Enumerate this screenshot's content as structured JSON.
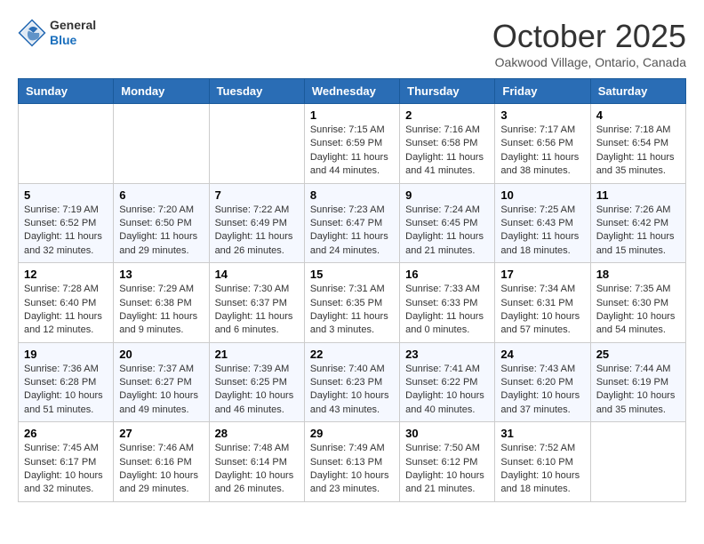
{
  "header": {
    "logo_line1": "General",
    "logo_line2": "Blue",
    "month": "October 2025",
    "location": "Oakwood Village, Ontario, Canada"
  },
  "weekdays": [
    "Sunday",
    "Monday",
    "Tuesday",
    "Wednesday",
    "Thursday",
    "Friday",
    "Saturday"
  ],
  "weeks": [
    [
      {
        "day": "",
        "sunrise": "",
        "sunset": "",
        "daylight": ""
      },
      {
        "day": "",
        "sunrise": "",
        "sunset": "",
        "daylight": ""
      },
      {
        "day": "",
        "sunrise": "",
        "sunset": "",
        "daylight": ""
      },
      {
        "day": "1",
        "sunrise": "Sunrise: 7:15 AM",
        "sunset": "Sunset: 6:59 PM",
        "daylight": "Daylight: 11 hours and 44 minutes."
      },
      {
        "day": "2",
        "sunrise": "Sunrise: 7:16 AM",
        "sunset": "Sunset: 6:58 PM",
        "daylight": "Daylight: 11 hours and 41 minutes."
      },
      {
        "day": "3",
        "sunrise": "Sunrise: 7:17 AM",
        "sunset": "Sunset: 6:56 PM",
        "daylight": "Daylight: 11 hours and 38 minutes."
      },
      {
        "day": "4",
        "sunrise": "Sunrise: 7:18 AM",
        "sunset": "Sunset: 6:54 PM",
        "daylight": "Daylight: 11 hours and 35 minutes."
      }
    ],
    [
      {
        "day": "5",
        "sunrise": "Sunrise: 7:19 AM",
        "sunset": "Sunset: 6:52 PM",
        "daylight": "Daylight: 11 hours and 32 minutes."
      },
      {
        "day": "6",
        "sunrise": "Sunrise: 7:20 AM",
        "sunset": "Sunset: 6:50 PM",
        "daylight": "Daylight: 11 hours and 29 minutes."
      },
      {
        "day": "7",
        "sunrise": "Sunrise: 7:22 AM",
        "sunset": "Sunset: 6:49 PM",
        "daylight": "Daylight: 11 hours and 26 minutes."
      },
      {
        "day": "8",
        "sunrise": "Sunrise: 7:23 AM",
        "sunset": "Sunset: 6:47 PM",
        "daylight": "Daylight: 11 hours and 24 minutes."
      },
      {
        "day": "9",
        "sunrise": "Sunrise: 7:24 AM",
        "sunset": "Sunset: 6:45 PM",
        "daylight": "Daylight: 11 hours and 21 minutes."
      },
      {
        "day": "10",
        "sunrise": "Sunrise: 7:25 AM",
        "sunset": "Sunset: 6:43 PM",
        "daylight": "Daylight: 11 hours and 18 minutes."
      },
      {
        "day": "11",
        "sunrise": "Sunrise: 7:26 AM",
        "sunset": "Sunset: 6:42 PM",
        "daylight": "Daylight: 11 hours and 15 minutes."
      }
    ],
    [
      {
        "day": "12",
        "sunrise": "Sunrise: 7:28 AM",
        "sunset": "Sunset: 6:40 PM",
        "daylight": "Daylight: 11 hours and 12 minutes."
      },
      {
        "day": "13",
        "sunrise": "Sunrise: 7:29 AM",
        "sunset": "Sunset: 6:38 PM",
        "daylight": "Daylight: 11 hours and 9 minutes."
      },
      {
        "day": "14",
        "sunrise": "Sunrise: 7:30 AM",
        "sunset": "Sunset: 6:37 PM",
        "daylight": "Daylight: 11 hours and 6 minutes."
      },
      {
        "day": "15",
        "sunrise": "Sunrise: 7:31 AM",
        "sunset": "Sunset: 6:35 PM",
        "daylight": "Daylight: 11 hours and 3 minutes."
      },
      {
        "day": "16",
        "sunrise": "Sunrise: 7:33 AM",
        "sunset": "Sunset: 6:33 PM",
        "daylight": "Daylight: 11 hours and 0 minutes."
      },
      {
        "day": "17",
        "sunrise": "Sunrise: 7:34 AM",
        "sunset": "Sunset: 6:31 PM",
        "daylight": "Daylight: 10 hours and 57 minutes."
      },
      {
        "day": "18",
        "sunrise": "Sunrise: 7:35 AM",
        "sunset": "Sunset: 6:30 PM",
        "daylight": "Daylight: 10 hours and 54 minutes."
      }
    ],
    [
      {
        "day": "19",
        "sunrise": "Sunrise: 7:36 AM",
        "sunset": "Sunset: 6:28 PM",
        "daylight": "Daylight: 10 hours and 51 minutes."
      },
      {
        "day": "20",
        "sunrise": "Sunrise: 7:37 AM",
        "sunset": "Sunset: 6:27 PM",
        "daylight": "Daylight: 10 hours and 49 minutes."
      },
      {
        "day": "21",
        "sunrise": "Sunrise: 7:39 AM",
        "sunset": "Sunset: 6:25 PM",
        "daylight": "Daylight: 10 hours and 46 minutes."
      },
      {
        "day": "22",
        "sunrise": "Sunrise: 7:40 AM",
        "sunset": "Sunset: 6:23 PM",
        "daylight": "Daylight: 10 hours and 43 minutes."
      },
      {
        "day": "23",
        "sunrise": "Sunrise: 7:41 AM",
        "sunset": "Sunset: 6:22 PM",
        "daylight": "Daylight: 10 hours and 40 minutes."
      },
      {
        "day": "24",
        "sunrise": "Sunrise: 7:43 AM",
        "sunset": "Sunset: 6:20 PM",
        "daylight": "Daylight: 10 hours and 37 minutes."
      },
      {
        "day": "25",
        "sunrise": "Sunrise: 7:44 AM",
        "sunset": "Sunset: 6:19 PM",
        "daylight": "Daylight: 10 hours and 35 minutes."
      }
    ],
    [
      {
        "day": "26",
        "sunrise": "Sunrise: 7:45 AM",
        "sunset": "Sunset: 6:17 PM",
        "daylight": "Daylight: 10 hours and 32 minutes."
      },
      {
        "day": "27",
        "sunrise": "Sunrise: 7:46 AM",
        "sunset": "Sunset: 6:16 PM",
        "daylight": "Daylight: 10 hours and 29 minutes."
      },
      {
        "day": "28",
        "sunrise": "Sunrise: 7:48 AM",
        "sunset": "Sunset: 6:14 PM",
        "daylight": "Daylight: 10 hours and 26 minutes."
      },
      {
        "day": "29",
        "sunrise": "Sunrise: 7:49 AM",
        "sunset": "Sunset: 6:13 PM",
        "daylight": "Daylight: 10 hours and 23 minutes."
      },
      {
        "day": "30",
        "sunrise": "Sunrise: 7:50 AM",
        "sunset": "Sunset: 6:12 PM",
        "daylight": "Daylight: 10 hours and 21 minutes."
      },
      {
        "day": "31",
        "sunrise": "Sunrise: 7:52 AM",
        "sunset": "Sunset: 6:10 PM",
        "daylight": "Daylight: 10 hours and 18 minutes."
      },
      {
        "day": "",
        "sunrise": "",
        "sunset": "",
        "daylight": ""
      }
    ]
  ]
}
